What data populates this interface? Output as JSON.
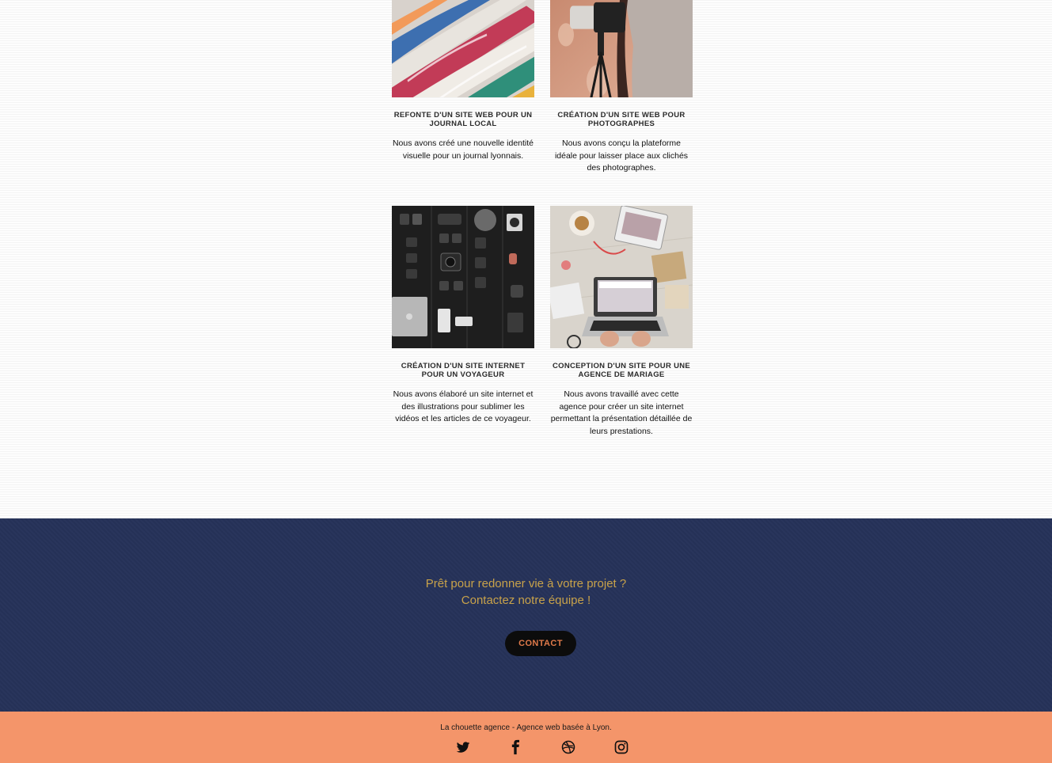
{
  "portfolio": {
    "projects": [
      {
        "title": "REFONTE D'UN SITE WEB POUR UN JOURNAL LOCAL",
        "description": "Nous avons créé une nouvelle identité visuelle pour un journal lyonnais.",
        "image": "magazines-photo"
      },
      {
        "title": "CRÉATION D'UN SITE WEB POUR PHOTOGRAPHES",
        "description": "Nous avons conçu la plateforme idéale pour laisser place aux clichés des photographes.",
        "image": "photographer-photo"
      },
      {
        "title": "CRÉATION D'UN SITE INTERNET POUR UN VOYAGEUR",
        "description": "Nous avons élaboré un site internet et des illustrations pour sublimer les vidéos et les articles de ce voyageur.",
        "image": "camera-gear-photo"
      },
      {
        "title": "CONCEPTION D'UN SITE POUR UNE AGENCE DE MARIAGE",
        "description": "Nous avons travaillé avec cette agence pour créer un site internet permettant la présentation détaillée de leurs prestations.",
        "image": "laptop-desk-photo"
      }
    ]
  },
  "cta": {
    "line1": "Prêt pour redonner vie à votre projet ?",
    "line2": "Contactez notre équipe !",
    "button_label": "CONTACT"
  },
  "footer": {
    "tagline": "La chouette agence - Agence web basée à Lyon.",
    "social": [
      "twitter-icon",
      "facebook-icon",
      "dribbble-icon",
      "instagram-icon"
    ]
  },
  "colors": {
    "cta_background": "#263259",
    "cta_text": "#c8a24a",
    "button_text": "#e07a4a",
    "footer_background": "#f4956a"
  }
}
